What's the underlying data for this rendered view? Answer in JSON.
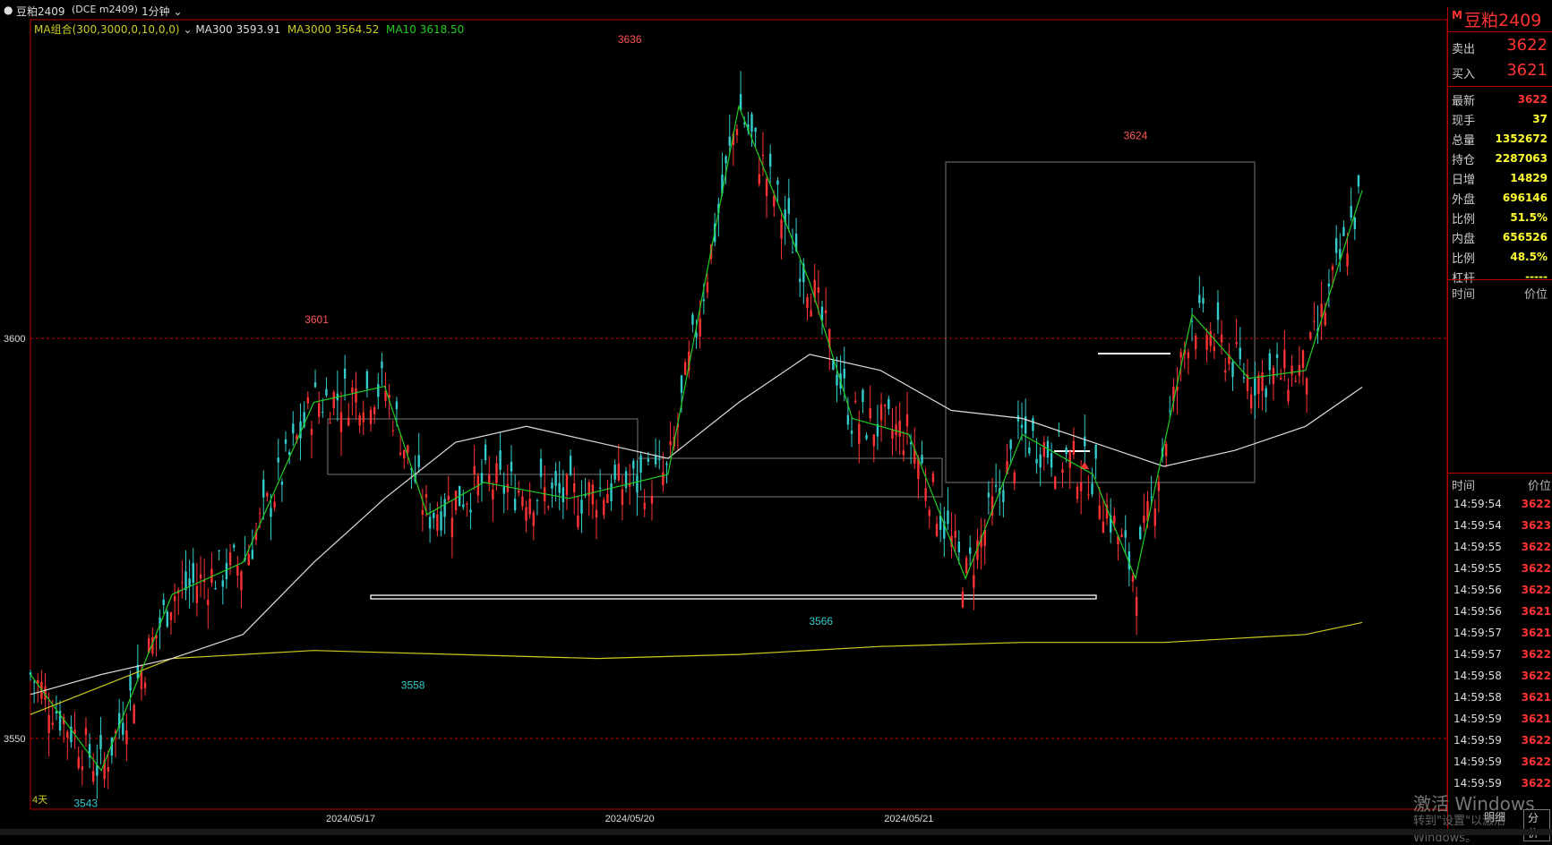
{
  "window": {
    "symbol_tab": "豆粕2409",
    "symbol_code": "(DCE m2409)",
    "period": "1分钟"
  },
  "indicator": {
    "label": "MA组合(300,3000,0,10,0,0)",
    "ma300": "MA300 3593.91",
    "ma3000": "MA3000 3564.52",
    "ma10": "MA10 3618.50",
    "colors": {
      "ma300": "#dddddd",
      "ma3000": "#cccc22",
      "ma10": "#22cc22"
    }
  },
  "chart_data": {
    "type": "candlestick",
    "y_ticks": [
      "3600",
      "3550"
    ],
    "x_ticks": [
      "2024/05/17",
      "2024/05/20",
      "2024/05/21"
    ],
    "period_label": "4天",
    "annotations": [
      "3543",
      "3601",
      "3558",
      "3636",
      "3566",
      "3624"
    ],
    "ma300": [
      [
        0,
        3555.5
      ],
      [
        0.05,
        3558
      ],
      [
        0.1,
        3560
      ],
      [
        0.15,
        3563
      ],
      [
        0.2,
        3572
      ],
      [
        0.25,
        3580
      ],
      [
        0.3,
        3587
      ],
      [
        0.35,
        3589
      ],
      [
        0.4,
        3587
      ],
      [
        0.45,
        3585
      ],
      [
        0.5,
        3592
      ],
      [
        0.55,
        3598
      ],
      [
        0.6,
        3596
      ],
      [
        0.63,
        3593
      ],
      [
        0.65,
        3591
      ],
      [
        0.7,
        3590
      ],
      [
        0.75,
        3587
      ],
      [
        0.8,
        3584
      ],
      [
        0.85,
        3586
      ],
      [
        0.9,
        3589
      ],
      [
        0.94,
        3593.9
      ]
    ],
    "ma3000": [
      [
        0,
        3553
      ],
      [
        0.1,
        3560
      ],
      [
        0.2,
        3561
      ],
      [
        0.3,
        3560.5
      ],
      [
        0.4,
        3560
      ],
      [
        0.5,
        3560.5
      ],
      [
        0.6,
        3561.5
      ],
      [
        0.7,
        3562
      ],
      [
        0.8,
        3562
      ],
      [
        0.9,
        3563
      ],
      [
        0.94,
        3564.5
      ]
    ],
    "ma10": [
      [
        0,
        3558
      ],
      [
        0.05,
        3546
      ],
      [
        0.1,
        3568
      ],
      [
        0.15,
        3572
      ],
      [
        0.2,
        3592
      ],
      [
        0.25,
        3594
      ],
      [
        0.28,
        3578
      ],
      [
        0.32,
        3582
      ],
      [
        0.38,
        3580
      ],
      [
        0.45,
        3583
      ],
      [
        0.5,
        3629
      ],
      [
        0.55,
        3607
      ],
      [
        0.58,
        3590
      ],
      [
        0.62,
        3588
      ],
      [
        0.66,
        3570
      ],
      [
        0.7,
        3588
      ],
      [
        0.75,
        3583
      ],
      [
        0.78,
        3570
      ],
      [
        0.82,
        3603
      ],
      [
        0.86,
        3595
      ],
      [
        0.9,
        3596
      ],
      [
        0.94,
        3618.5
      ]
    ],
    "colors": {
      "up": "#ff3333",
      "down": "#33cccc",
      "grid": "#cc0000"
    }
  },
  "panel": {
    "title": "豆粕2409",
    "sell_label": "卖出",
    "sell_price": "3622",
    "buy_label": "买入",
    "buy_price": "3621",
    "rows": [
      {
        "k": "最新",
        "v": "3622",
        "c": "#ff3333"
      },
      {
        "k": "现手",
        "v": "37",
        "c": "#ffff33"
      },
      {
        "k": "总量",
        "v": "1352672",
        "c": "#ffff33"
      },
      {
        "k": "持仓",
        "v": "2287063",
        "c": "#ffff33"
      },
      {
        "k": "日增",
        "v": "14829",
        "c": "#ffff33"
      },
      {
        "k": "外盘",
        "v": "696146",
        "c": "#ffff33"
      },
      {
        "k": "比例",
        "v": "51.5%",
        "c": "#ffff33"
      },
      {
        "k": "内盘",
        "v": "656526",
        "c": "#ffff33"
      },
      {
        "k": "比例",
        "v": "48.5%",
        "c": "#ffff33"
      },
      {
        "k": "杠杆",
        "v": "-----",
        "c": "#ffff33"
      }
    ],
    "header1_time": "时间",
    "header1_price": "价位",
    "header2_time": "时间",
    "header2_price": "价位",
    "ticks": [
      {
        "t": "14:59:54",
        "p": "3622",
        "c": "#ff3333"
      },
      {
        "t": "14:59:54",
        "p": "3623",
        "c": "#ff3333"
      },
      {
        "t": "14:59:55",
        "p": "3622",
        "c": "#ff3333"
      },
      {
        "t": "14:59:55",
        "p": "3622",
        "c": "#ff3333"
      },
      {
        "t": "14:59:56",
        "p": "3622",
        "c": "#ff3333"
      },
      {
        "t": "14:59:56",
        "p": "3621",
        "c": "#ff3333"
      },
      {
        "t": "14:59:57",
        "p": "3621",
        "c": "#ff3333"
      },
      {
        "t": "14:59:57",
        "p": "3622",
        "c": "#ff3333"
      },
      {
        "t": "14:59:58",
        "p": "3622",
        "c": "#ff3333"
      },
      {
        "t": "14:59:58",
        "p": "3621",
        "c": "#ff3333"
      },
      {
        "t": "14:59:59",
        "p": "3621",
        "c": "#ff3333"
      },
      {
        "t": "14:59:59",
        "p": "3622",
        "c": "#ff3333"
      },
      {
        "t": "14:59:59",
        "p": "3622",
        "c": "#ff3333"
      },
      {
        "t": "14:59:59",
        "p": "3622",
        "c": "#ff3333"
      }
    ],
    "tab_detail": "明细",
    "tab_time": "分价"
  },
  "watermark": {
    "line1": "激活 Windows",
    "line2": "转到\"设置\"以激活 Windows。"
  }
}
